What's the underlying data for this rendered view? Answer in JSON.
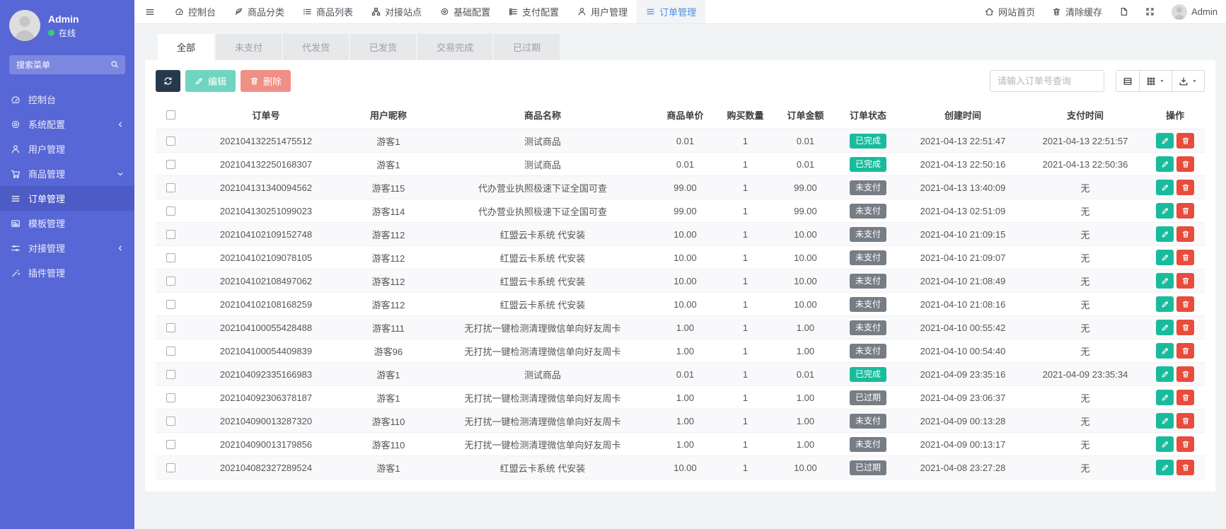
{
  "sidebar": {
    "user": {
      "name": "Admin",
      "status_label": "在线"
    },
    "search_placeholder": "搜索菜单",
    "items": [
      {
        "label": "控制台",
        "icon": "dashboard-icon"
      },
      {
        "label": "系统配置",
        "icon": "gear-icon"
      },
      {
        "label": "用户管理",
        "icon": "user-icon"
      },
      {
        "label": "商品管理",
        "icon": "cart-icon"
      },
      {
        "label": "订单管理",
        "icon": "order-list-icon"
      },
      {
        "label": "模板管理",
        "icon": "template-icon"
      },
      {
        "label": "对接管理",
        "icon": "sliders-icon"
      },
      {
        "label": "插件管理",
        "icon": "plugin-icon"
      }
    ]
  },
  "topbar": {
    "nav": [
      {
        "label": "控制台",
        "icon": "dashboard-icon"
      },
      {
        "label": "商品分类",
        "icon": "leaf-icon"
      },
      {
        "label": "商品列表",
        "icon": "list-icon"
      },
      {
        "label": "对接站点",
        "icon": "sitemap-icon"
      },
      {
        "label": "基础配置",
        "icon": "gear-icon"
      },
      {
        "label": "支付配置",
        "icon": "th-list-icon"
      },
      {
        "label": "用户管理",
        "icon": "user-icon"
      },
      {
        "label": "订单管理",
        "icon": "order-list-icon"
      }
    ],
    "home_label": "网站首页",
    "clear_cache_label": "清除缓存",
    "username": "Admin"
  },
  "tabs": [
    {
      "label": "全部"
    },
    {
      "label": "未支付"
    },
    {
      "label": "代发货"
    },
    {
      "label": "已发货"
    },
    {
      "label": "交易完成"
    },
    {
      "label": "已过期"
    }
  ],
  "toolbar": {
    "edit_label": "编辑",
    "delete_label": "删除",
    "search_placeholder": "请输入订单号查询"
  },
  "table": {
    "headers": [
      "订单号",
      "用户昵称",
      "商品名称",
      "商品单价",
      "购买数量",
      "订单金额",
      "订单状态",
      "创建时间",
      "支付时间",
      "操作"
    ],
    "rows": [
      {
        "order_no": "202104132251475512",
        "nickname": "游客1",
        "product": "测试商品",
        "price": "0.01",
        "qty": "1",
        "amount": "0.01",
        "status": "已完成",
        "status_type": "success",
        "created": "2021-04-13 22:51:47",
        "paid": "2021-04-13 22:51:57"
      },
      {
        "order_no": "202104132250168307",
        "nickname": "游客1",
        "product": "测试商品",
        "price": "0.01",
        "qty": "1",
        "amount": "0.01",
        "status": "已完成",
        "status_type": "success",
        "created": "2021-04-13 22:50:16",
        "paid": "2021-04-13 22:50:36"
      },
      {
        "order_no": "202104131340094562",
        "nickname": "游客115",
        "product": "代办营业执照极速下证全国可查",
        "price": "99.00",
        "qty": "1",
        "amount": "99.00",
        "status": "未支付",
        "status_type": "gray",
        "created": "2021-04-13 13:40:09",
        "paid": "无"
      },
      {
        "order_no": "202104130251099023",
        "nickname": "游客114",
        "product": "代办营业执照极速下证全国可查",
        "price": "99.00",
        "qty": "1",
        "amount": "99.00",
        "status": "未支付",
        "status_type": "gray",
        "created": "2021-04-13 02:51:09",
        "paid": "无"
      },
      {
        "order_no": "202104102109152748",
        "nickname": "游客112",
        "product": "红盟云卡系统 代安装",
        "price": "10.00",
        "qty": "1",
        "amount": "10.00",
        "status": "未支付",
        "status_type": "gray",
        "created": "2021-04-10 21:09:15",
        "paid": "无"
      },
      {
        "order_no": "202104102109078105",
        "nickname": "游客112",
        "product": "红盟云卡系统 代安装",
        "price": "10.00",
        "qty": "1",
        "amount": "10.00",
        "status": "未支付",
        "status_type": "gray",
        "created": "2021-04-10 21:09:07",
        "paid": "无"
      },
      {
        "order_no": "202104102108497062",
        "nickname": "游客112",
        "product": "红盟云卡系统 代安装",
        "price": "10.00",
        "qty": "1",
        "amount": "10.00",
        "status": "未支付",
        "status_type": "gray",
        "created": "2021-04-10 21:08:49",
        "paid": "无"
      },
      {
        "order_no": "202104102108168259",
        "nickname": "游客112",
        "product": "红盟云卡系统 代安装",
        "price": "10.00",
        "qty": "1",
        "amount": "10.00",
        "status": "未支付",
        "status_type": "gray",
        "created": "2021-04-10 21:08:16",
        "paid": "无"
      },
      {
        "order_no": "202104100055428488",
        "nickname": "游客111",
        "product": "无打扰一键检测清理微信单向好友周卡",
        "price": "1.00",
        "qty": "1",
        "amount": "1.00",
        "status": "未支付",
        "status_type": "gray",
        "created": "2021-04-10 00:55:42",
        "paid": "无"
      },
      {
        "order_no": "202104100054409839",
        "nickname": "游客96",
        "product": "无打扰一键检测清理微信单向好友周卡",
        "price": "1.00",
        "qty": "1",
        "amount": "1.00",
        "status": "未支付",
        "status_type": "gray",
        "created": "2021-04-10 00:54:40",
        "paid": "无"
      },
      {
        "order_no": "202104092335166983",
        "nickname": "游客1",
        "product": "测试商品",
        "price": "0.01",
        "qty": "1",
        "amount": "0.01",
        "status": "已完成",
        "status_type": "success",
        "created": "2021-04-09 23:35:16",
        "paid": "2021-04-09 23:35:34"
      },
      {
        "order_no": "202104092306378187",
        "nickname": "游客1",
        "product": "无打扰一键检测清理微信单向好友周卡",
        "price": "1.00",
        "qty": "1",
        "amount": "1.00",
        "status": "已过期",
        "status_type": "gray",
        "created": "2021-04-09 23:06:37",
        "paid": "无"
      },
      {
        "order_no": "202104090013287320",
        "nickname": "游客110",
        "product": "无打扰一键检测清理微信单向好友周卡",
        "price": "1.00",
        "qty": "1",
        "amount": "1.00",
        "status": "未支付",
        "status_type": "gray",
        "created": "2021-04-09 00:13:28",
        "paid": "无"
      },
      {
        "order_no": "202104090013179856",
        "nickname": "游客110",
        "product": "无打扰一键检测清理微信单向好友周卡",
        "price": "1.00",
        "qty": "1",
        "amount": "1.00",
        "status": "未支付",
        "status_type": "gray",
        "created": "2021-04-09 00:13:17",
        "paid": "无"
      },
      {
        "order_no": "202104082327289524",
        "nickname": "游客1",
        "product": "红盟云卡系统 代安装",
        "price": "10.00",
        "qty": "1",
        "amount": "10.00",
        "status": "已过期",
        "status_type": "gray",
        "created": "2021-04-08 23:27:28",
        "paid": "无"
      }
    ]
  },
  "colors": {
    "sidebar_accent": "#5867d6",
    "success": "#18bc9c",
    "danger": "#e74c3c",
    "dark_button": "#273a4d",
    "muted_badge": "#767d85",
    "topnav_active_text": "#4a8fe2",
    "online_dot": "#2fd573"
  }
}
